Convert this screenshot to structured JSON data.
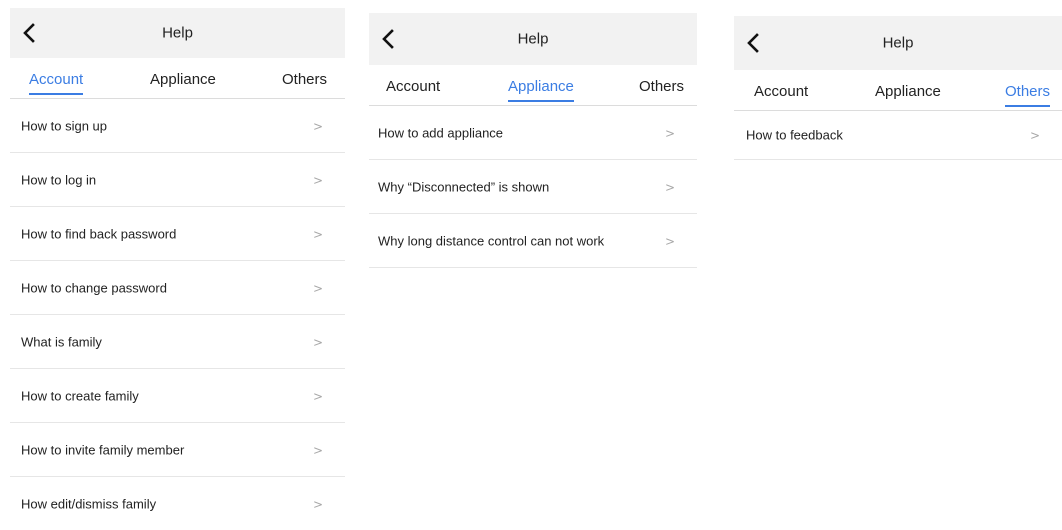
{
  "screens": [
    {
      "header": {
        "title": "Help"
      },
      "tabs": [
        {
          "label": "Account",
          "active": true
        },
        {
          "label": "Appliance",
          "active": false
        },
        {
          "label": "Others",
          "active": false
        }
      ],
      "items": [
        {
          "label": "How to sign up",
          "chevron": ">"
        },
        {
          "label": "How to log in",
          "chevron": ">"
        },
        {
          "label": "How to find back password",
          "chevron": ">"
        },
        {
          "label": "How to change password",
          "chevron": ">"
        },
        {
          "label": "What is family",
          "chevron": ">"
        },
        {
          "label": "How to create family",
          "chevron": ">"
        },
        {
          "label": "How to invite family member",
          "chevron": ">"
        },
        {
          "label": "How edit/dismiss family",
          "chevron": ">"
        }
      ]
    },
    {
      "header": {
        "title": "Help"
      },
      "tabs": [
        {
          "label": "Account",
          "active": false
        },
        {
          "label": "Appliance",
          "active": true
        },
        {
          "label": "Others",
          "active": false
        }
      ],
      "items": [
        {
          "label": "How to add appliance",
          "chevron": ">"
        },
        {
          "label": "Why “Disconnected” is shown",
          "chevron": ">"
        },
        {
          "label": "Why long distance control can not work",
          "chevron": ">"
        }
      ]
    },
    {
      "header": {
        "title": "Help"
      },
      "tabs": [
        {
          "label": "Account",
          "active": false
        },
        {
          "label": "Appliance",
          "active": false
        },
        {
          "label": "Others",
          "active": true
        }
      ],
      "items": [
        {
          "label": "How to feedback",
          "chevron": ">"
        }
      ]
    }
  ],
  "icons": {
    "back": "back-arrow-icon",
    "chevron": "chevron-right-icon"
  },
  "colors": {
    "accent": "#3b7de3",
    "header_bg": "#f2f2f2",
    "divider": "#e6e6e6",
    "chevron": "#a8a8a8"
  }
}
